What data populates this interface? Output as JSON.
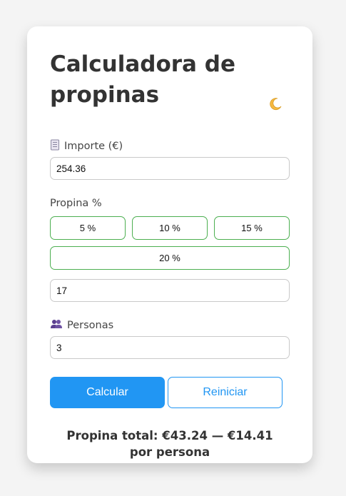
{
  "app": {
    "title": "Calculadora de propinas",
    "theme_toggle_icon": "crescent-moon-icon"
  },
  "amount": {
    "icon": "receipt-icon",
    "label": "Importe (€)",
    "value": "254.36"
  },
  "tip": {
    "label": "Propina %",
    "presets": [
      "5 %",
      "10 %",
      "15 %",
      "20 %"
    ],
    "custom_value": "17"
  },
  "people": {
    "icon": "people-icon",
    "label": "Personas",
    "value": "3"
  },
  "actions": {
    "calculate_label": "Calcular",
    "reset_label": "Reiniciar"
  },
  "result": {
    "text": "Propina total: €43.24 — €14.41 por persona"
  },
  "colors": {
    "primary": "#2196f3",
    "preset_border": "#4caf50",
    "background": "#f4f4f4",
    "card": "#ffffff"
  }
}
